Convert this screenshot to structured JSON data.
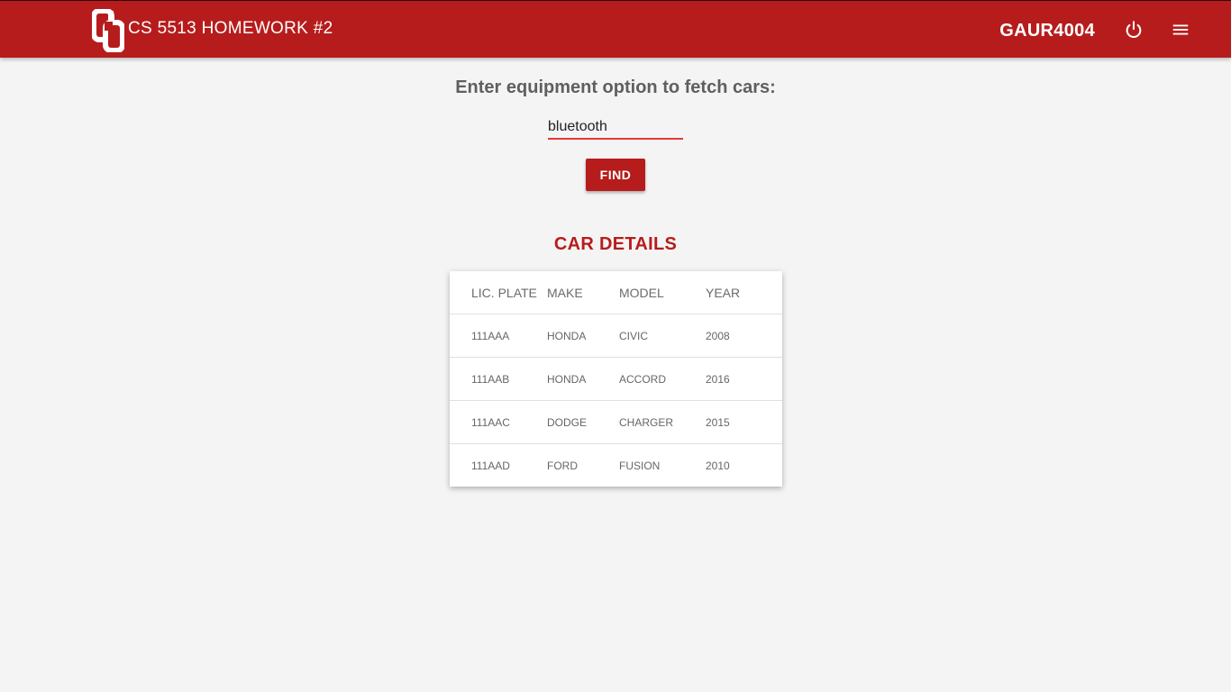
{
  "header": {
    "title": "CS 5513 HOMEWORK #2",
    "username": "GAUR4004",
    "logo_icon": "ou-logo-icon",
    "power_icon": "power-icon",
    "menu_icon": "menu-icon"
  },
  "search": {
    "prompt": "Enter equipment option to fetch cars:",
    "value": "bluetooth",
    "button_label": "FIND"
  },
  "results": {
    "title": "CAR DETAILS",
    "columns": [
      "LIC. PLATE",
      "MAKE",
      "MODEL",
      "YEAR"
    ],
    "rows": [
      [
        "111AAA",
        "HONDA",
        "CIVIC",
        "2008"
      ],
      [
        "111AAB",
        "HONDA",
        "ACCORD",
        "2016"
      ],
      [
        "111AAC",
        "DODGE",
        "CHARGER",
        "2015"
      ],
      [
        "111AAD",
        "FORD",
        "FUSION",
        "2010"
      ]
    ]
  },
  "colors": {
    "brand": "#b71c1c",
    "background": "#f4f4f4",
    "input_underline": "#e53935"
  }
}
